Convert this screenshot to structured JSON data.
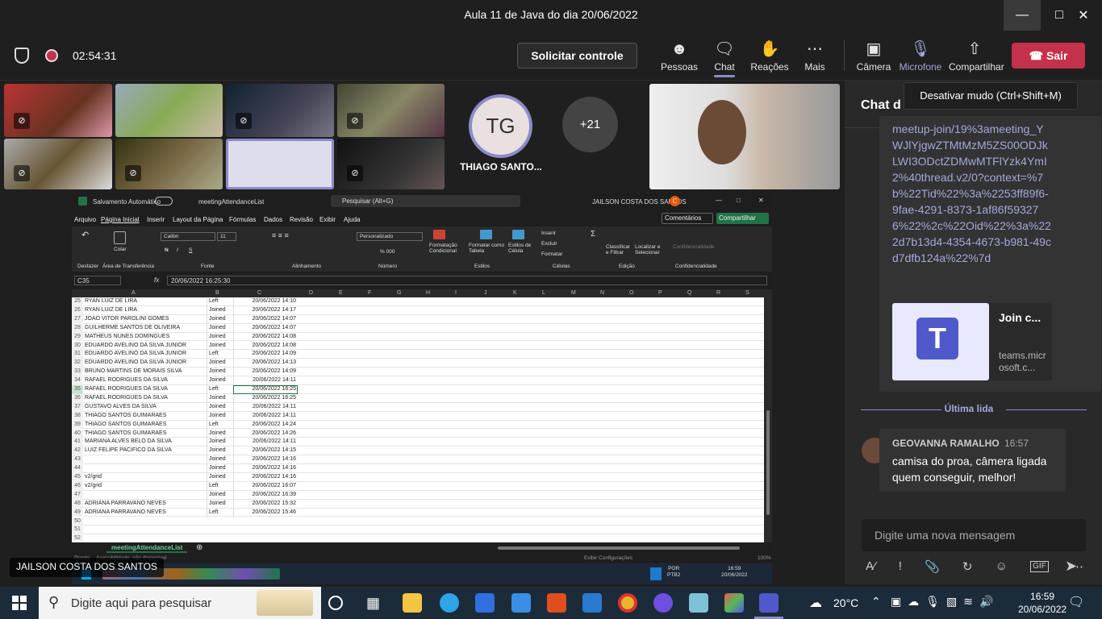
{
  "window": {
    "title": "Aula 11 de Java do dia 20/06/2022"
  },
  "meeting": {
    "timer": "02:54:31",
    "request_control": "Solicitar controle",
    "buttons": {
      "people": "Pessoas",
      "chat": "Chat",
      "reactions": "Reações",
      "more": "Mais",
      "camera": "Câmera",
      "mic": "Microfone",
      "share": "Compartilhar",
      "leave": "Sair"
    },
    "tooltip": "Desativar mudo (Ctrl+Shift+M)",
    "participant_initials": "TG",
    "participant_name": "THIAGO SANTO...",
    "overflow_count": "+21",
    "presenter_label": "JAILSON COSTA DOS SANTOS"
  },
  "excel": {
    "autosave": "Salvamento Automático",
    "filename": "meetingAttendanceList",
    "search": "Pesquisar (Alt+G)",
    "user": "JAILSON COSTA DOS SANTOS",
    "user_initial": "C",
    "menu": [
      "Arquivo",
      "Página Inicial",
      "Inserir",
      "Layout da Página",
      "Fórmulas",
      "Dados",
      "Revisão",
      "Exibir",
      "Ajuda"
    ],
    "comments": "Comentários",
    "share": "Compartilhar",
    "ribbon": {
      "undo": "Desfazer",
      "clipboard": "Área de Transferência",
      "paste": "Colar",
      "font_name": "Calibri",
      "font_size": "11",
      "font_group": "Fonte",
      "align_group": "Alinhamento",
      "number_format": "Personalizado",
      "number_group": "Número",
      "cond_format": "Formatação Condicional",
      "format_table": "Formatar como Tabela",
      "cell_styles": "Estilos de Célula",
      "styles_group": "Estilos",
      "insert": "Inserir",
      "delete": "Excluir",
      "format": "Formatar",
      "cells_group": "Células",
      "sort": "Classificar e Filtrar",
      "find": "Localizar e Selecionar",
      "edit_group": "Edição",
      "confidential": "Confidencialidade"
    },
    "namebox": "C35",
    "formula": "20/06/2022  16:25:30",
    "columns": [
      "A",
      "B",
      "C",
      "D",
      "E",
      "F",
      "G",
      "H",
      "I",
      "J",
      "K",
      "L",
      "M",
      "N",
      "O",
      "P",
      "Q",
      "R",
      "S"
    ],
    "rows": [
      {
        "n": "25",
        "a": "RYAN LUIZ DE LIRA",
        "b": "Left",
        "c": "20/06/2022 14:10"
      },
      {
        "n": "26",
        "a": "RYAN LUIZ DE LIRA",
        "b": "Joined",
        "c": "20/06/2022 14:17"
      },
      {
        "n": "27",
        "a": "JOAO VITOR PAROLINI GOMES",
        "b": "Joined",
        "c": "20/06/2022 14:07"
      },
      {
        "n": "28",
        "a": "GUILHERME SANTOS DE OLIVEIRA",
        "b": "Joined",
        "c": "20/06/2022 14:07"
      },
      {
        "n": "29",
        "a": "MATHEUS NUNES DOMINGUES",
        "b": "Joined",
        "c": "20/06/2022 14:08"
      },
      {
        "n": "30",
        "a": "EDUARDO AVELINO DA SILVA JUNIOR",
        "b": "Joined",
        "c": "20/06/2022 14:08"
      },
      {
        "n": "31",
        "a": "EDUARDO AVELINO DA SILVA JUNIOR",
        "b": "Left",
        "c": "20/06/2022 14:09"
      },
      {
        "n": "32",
        "a": "EDUARDO AVELINO DA SILVA JUNIOR",
        "b": "Joined",
        "c": "20/06/2022 14:13"
      },
      {
        "n": "33",
        "a": "BRUNO MARTINS DE MORAIS SILVA",
        "b": "Joined",
        "c": "20/06/2022 14:09"
      },
      {
        "n": "34",
        "a": "RAFAEL RODRIGUES DA SILVA",
        "b": "Joined",
        "c": "20/06/2022 14:11"
      },
      {
        "n": "35",
        "a": "RAFAEL RODRIGUES DA SILVA",
        "b": "Left",
        "c": "20/06/2022 16:25"
      },
      {
        "n": "36",
        "a": "RAFAEL RODRIGUES DA SILVA",
        "b": "Joined",
        "c": "20/06/2022 16:25"
      },
      {
        "n": "37",
        "a": "GUSTAVO ALVES DA SILVA",
        "b": "Joined",
        "c": "20/06/2022 14:11"
      },
      {
        "n": "38",
        "a": "THIAGO SANTOS GUIMARAES",
        "b": "Joined",
        "c": "20/06/2022 14:11"
      },
      {
        "n": "39",
        "a": "THIAGO SANTOS GUIMARAES",
        "b": "Left",
        "c": "20/06/2022 14:24"
      },
      {
        "n": "40",
        "a": "THIAGO SANTOS GUIMARAES",
        "b": "Joined",
        "c": "20/06/2022 14:26"
      },
      {
        "n": "41",
        "a": "MARIANA ALVES BELO DA SILVA",
        "b": "Joined",
        "c": "20/06/2022 14:11"
      },
      {
        "n": "42",
        "a": "LUIZ FELIPE PACIFICO DA SILVA",
        "b": "Joined",
        "c": "20/06/2022 14:15"
      },
      {
        "n": "43",
        "a": "",
        "b": "Joined",
        "c": "20/06/2022 14:16"
      },
      {
        "n": "44",
        "a": "",
        "b": "Joined",
        "c": "20/06/2022 14:16"
      },
      {
        "n": "45",
        "a": "v2/grid",
        "b": "Joined",
        "c": "20/06/2022 14:16"
      },
      {
        "n": "46",
        "a": "v2/grid",
        "b": "Left",
        "c": "20/06/2022 16:07"
      },
      {
        "n": "47",
        "a": "",
        "b": "Joined",
        "c": "20/06/2022 16:39"
      },
      {
        "n": "48",
        "a": "ADRIANA PARRAVANO NEVES",
        "b": "Joined",
        "c": "20/06/2022 15:32"
      },
      {
        "n": "49",
        "a": "ADRIANA PARRAVANO NEVES",
        "b": "Left",
        "c": "20/06/2022 15:46"
      },
      {
        "n": "50",
        "a": "",
        "b": "",
        "c": ""
      },
      {
        "n": "51",
        "a": "",
        "b": "",
        "c": ""
      },
      {
        "n": "52",
        "a": "",
        "b": "",
        "c": ""
      }
    ],
    "sheet_tab": "meetingAttendanceList",
    "status_ready": "Pronto",
    "status_access": "Acessibilidade: não disponível",
    "status_display": "Exibir Configurações",
    "zoom": "100%",
    "remote_tray": {
      "lang": "POR",
      "kbd": "PTB2",
      "time": "16:59",
      "date": "20/06/2022"
    }
  },
  "chat": {
    "title": "Chat d",
    "link_text": "meetup-join/19%3ameeting_YWJlYjgwZTMtMzM5ZS00ODJkLWI3ODctZDMwMTFlYzk4YmI2%40thread.v2/0?context=%7b%22Tid%22%3a%2253ff89f6-9fae-4291-8373-1af86f593276%22%2c%22Oid%22%3a%222d7b13d4-4354-4673-b981-49cd7dfb124a%22%7d",
    "card_title": "Join c...",
    "card_url": "teams.microsoft.c...",
    "last_read": "Última lida",
    "message": {
      "author": "GEOVANNA RAMALHO",
      "time": "16:57",
      "text": "camisa do proa, câmera ligada quem conseguir, melhor!"
    },
    "input_placeholder": "Digite uma nova mensagem"
  },
  "taskbar": {
    "search_placeholder": "Digite aqui para pesquisar",
    "weather": "20°C",
    "time": "16:59",
    "date": "20/06/2022"
  },
  "colors": {
    "accent": "#6264a7",
    "leave": "#c4314b",
    "excel_green": "#217346",
    "link": "#a6a7dc"
  }
}
